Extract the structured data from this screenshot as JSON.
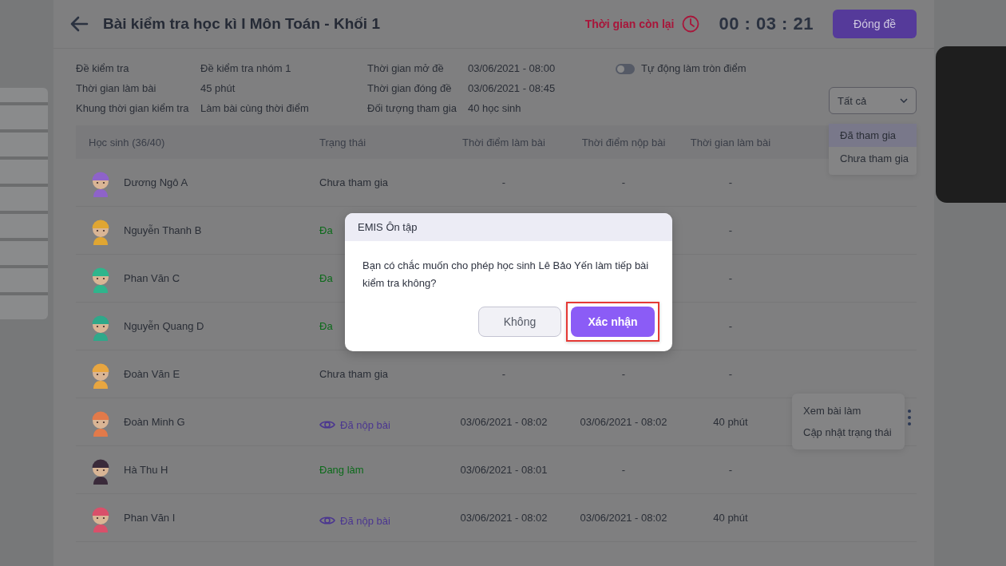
{
  "header": {
    "title": "Bài kiểm tra học kì I Môn Toán - Khối 1",
    "timer_label": "Thời gian còn lại",
    "timer": "00 : 03 : 21",
    "close_button": "Đóng đề"
  },
  "info": [
    {
      "label": "Đề kiểm tra",
      "value": "Đề kiểm tra nhóm 1"
    },
    {
      "label": "Thời gian mở đề",
      "value": "03/06/2021 - 08:00"
    },
    {
      "label": "Thời gian làm bài",
      "value": "45 phút"
    },
    {
      "label": "Thời gian đóng đề",
      "value": "03/06/2021 - 08:45"
    },
    {
      "label": "Khung thời gian kiểm tra",
      "value": "Làm bài cùng thời điểm"
    },
    {
      "label": "Đối tượng tham gia",
      "value": "40 học sinh"
    }
  ],
  "auto_round": {
    "label": "Tự động làm tròn điểm",
    "on": false
  },
  "filter": {
    "value": "Tất cả",
    "expanded": true,
    "options": [
      {
        "label": "Đã tham gia",
        "selected": true
      },
      {
        "label": "Chưa tham gia",
        "selected": false
      }
    ]
  },
  "table": {
    "columns": [
      "Học sinh (36/40)",
      "Trạng thái",
      "Thời điểm làm bài",
      "Thời điểm nộp bài",
      "Thời gian làm bài"
    ],
    "rows": [
      {
        "name": "Dương Ngô A",
        "color": "#8e63c9",
        "status": {
          "kind": "absent",
          "text": "Chưa tham gia"
        },
        "start": "-",
        "submit": "-",
        "duration": "-"
      },
      {
        "name": "Nguyễn Thanh B",
        "color": "#e0a632",
        "status": {
          "kind": "working",
          "text": "Đa"
        },
        "duration": "-"
      },
      {
        "name": "Phan Văn C",
        "color": "#2fb58c",
        "status": {
          "kind": "working",
          "text": "Đa"
        },
        "duration": "-"
      },
      {
        "name": "Nguyễn Quang D",
        "color": "#2fa88a",
        "status": {
          "kind": "working",
          "text": "Đa"
        },
        "duration": "-"
      },
      {
        "name": "Đoàn Văn E",
        "color": "#e8a640",
        "status": {
          "kind": "absent",
          "text": "Chưa tham gia"
        },
        "start": "-",
        "submit": "-",
        "duration": "-"
      },
      {
        "name": "Đoàn Minh G",
        "color": "#e27a4a",
        "status": {
          "kind": "submitted",
          "text": "Đã nộp bài"
        },
        "start": "03/06/2021 - 08:02",
        "submit": "03/06/2021 - 08:02",
        "duration": "40 phút",
        "menu": [
          "Xem bài làm",
          "Cập nhật trạng thái"
        ]
      },
      {
        "name": "Hà Thu H",
        "color": "#3a2a3a",
        "status": {
          "kind": "working",
          "text": "Đang làm"
        },
        "start": "03/06/2021 - 08:01",
        "submit": "-",
        "duration": "-"
      },
      {
        "name": "Phan Văn I",
        "color": "#d9506a",
        "status": {
          "kind": "submitted",
          "text": "Đã nộp bài"
        },
        "start": "03/06/2021 - 08:02",
        "submit": "03/06/2021 - 08:02",
        "duration": "40 phút"
      }
    ]
  },
  "dialog": {
    "title": "EMIS Ôn tập",
    "message": "Bạn có chắc muốn cho phép học sinh Lê Bảo Yến làm tiếp bài kiểm tra không?",
    "buttons": [
      {
        "label": "Không",
        "kind": "secondary",
        "highlighted": false
      },
      {
        "label": "Xác nhận",
        "kind": "primary",
        "highlighted": true
      }
    ]
  }
}
